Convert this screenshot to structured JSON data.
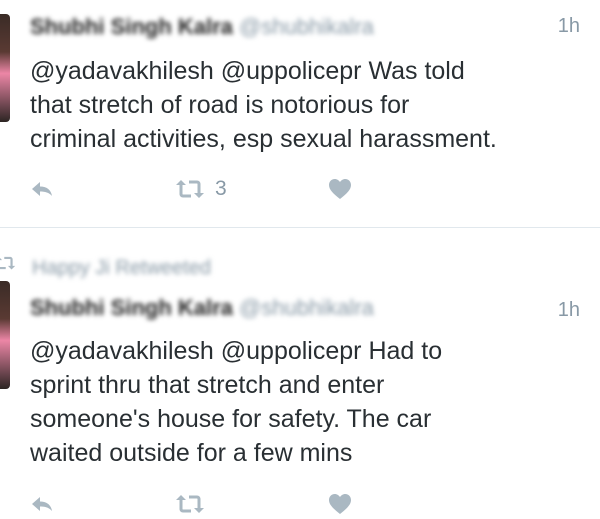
{
  "tweets": [
    {
      "name": "Shubhi Singh Kalra",
      "handle": "@shubhikalra",
      "time": "1h",
      "text": "@yadavakhilesh @uppolicepr Was told\nthat stretch of road is notorious for\ncriminal activities, esp sexual harassment.",
      "retweet_count": "3"
    },
    {
      "retweeted_by": "Happy Ji Retweeted",
      "name": "Shubhi Singh Kalra",
      "handle": "@shubhikalra",
      "time": "1h",
      "text": "@yadavakhilesh @uppolicepr Had to\nsprint thru that stretch and enter\nsomeone's house for safety. The car\nwaited outside for a few mins"
    }
  ],
  "colors": {
    "text": "#292f33",
    "secondary": "#8899a6",
    "icon": "#aab8c2",
    "divider": "#e1e8ed"
  },
  "icons": [
    "reply-icon",
    "retweet-icon",
    "like-icon"
  ]
}
